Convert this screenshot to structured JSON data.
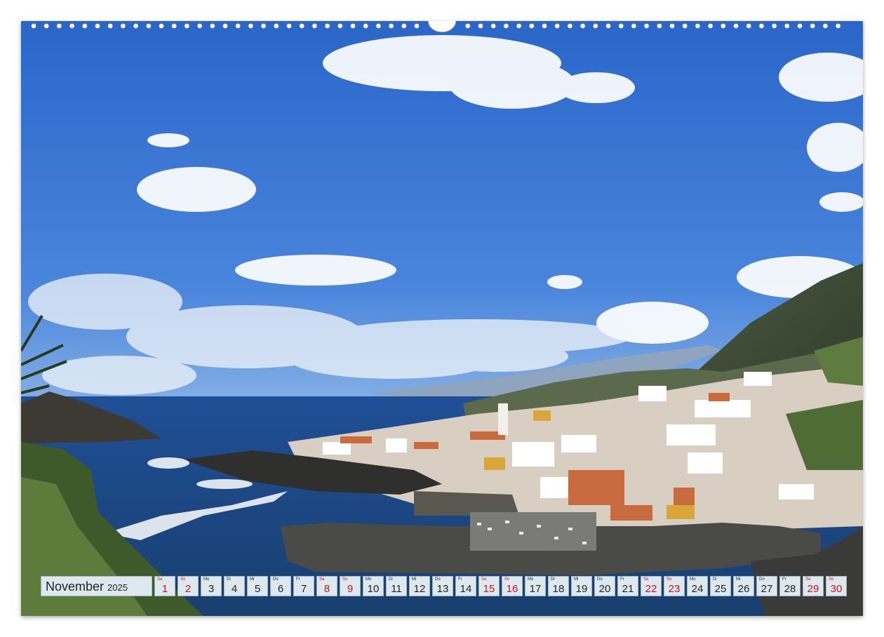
{
  "calendar": {
    "month": "November",
    "year": "2025",
    "days": [
      {
        "wd": "Sa",
        "d": "1",
        "weekend": true
      },
      {
        "wd": "So",
        "d": "2",
        "weekend": true
      },
      {
        "wd": "Mo",
        "d": "3",
        "weekend": false
      },
      {
        "wd": "Di",
        "d": "4",
        "weekend": false
      },
      {
        "wd": "Mi",
        "d": "5",
        "weekend": false
      },
      {
        "wd": "Do",
        "d": "6",
        "weekend": false
      },
      {
        "wd": "Fr",
        "d": "7",
        "weekend": false
      },
      {
        "wd": "Sa",
        "d": "8",
        "weekend": true
      },
      {
        "wd": "So",
        "d": "9",
        "weekend": true
      },
      {
        "wd": "Mo",
        "d": "10",
        "weekend": false
      },
      {
        "wd": "Di",
        "d": "11",
        "weekend": false
      },
      {
        "wd": "Mi",
        "d": "12",
        "weekend": false
      },
      {
        "wd": "Do",
        "d": "13",
        "weekend": false
      },
      {
        "wd": "Fr",
        "d": "14",
        "weekend": false
      },
      {
        "wd": "Sa",
        "d": "15",
        "weekend": true
      },
      {
        "wd": "So",
        "d": "16",
        "weekend": true
      },
      {
        "wd": "Mo",
        "d": "17",
        "weekend": false
      },
      {
        "wd": "Di",
        "d": "18",
        "weekend": false
      },
      {
        "wd": "Mi",
        "d": "19",
        "weekend": false
      },
      {
        "wd": "Do",
        "d": "20",
        "weekend": false
      },
      {
        "wd": "Fr",
        "d": "21",
        "weekend": false
      },
      {
        "wd": "Sa",
        "d": "22",
        "weekend": true
      },
      {
        "wd": "So",
        "d": "23",
        "weekend": true
      },
      {
        "wd": "Mo",
        "d": "24",
        "weekend": false
      },
      {
        "wd": "Di",
        "d": "25",
        "weekend": false
      },
      {
        "wd": "Mi",
        "d": "26",
        "weekend": false
      },
      {
        "wd": "Do",
        "d": "27",
        "weekend": false
      },
      {
        "wd": "Fr",
        "d": "28",
        "weekend": false
      },
      {
        "wd": "Sa",
        "d": "29",
        "weekend": true
      },
      {
        "wd": "So",
        "d": "30",
        "weekend": true
      }
    ]
  },
  "colors": {
    "weekend_text": "#c4141c",
    "cell_background": "#dde9ef",
    "sky_top": "#2a66c9",
    "sea": "#1c4f86"
  },
  "icons": [
    "binding-ring-icon",
    "hanger-notch-icon"
  ]
}
